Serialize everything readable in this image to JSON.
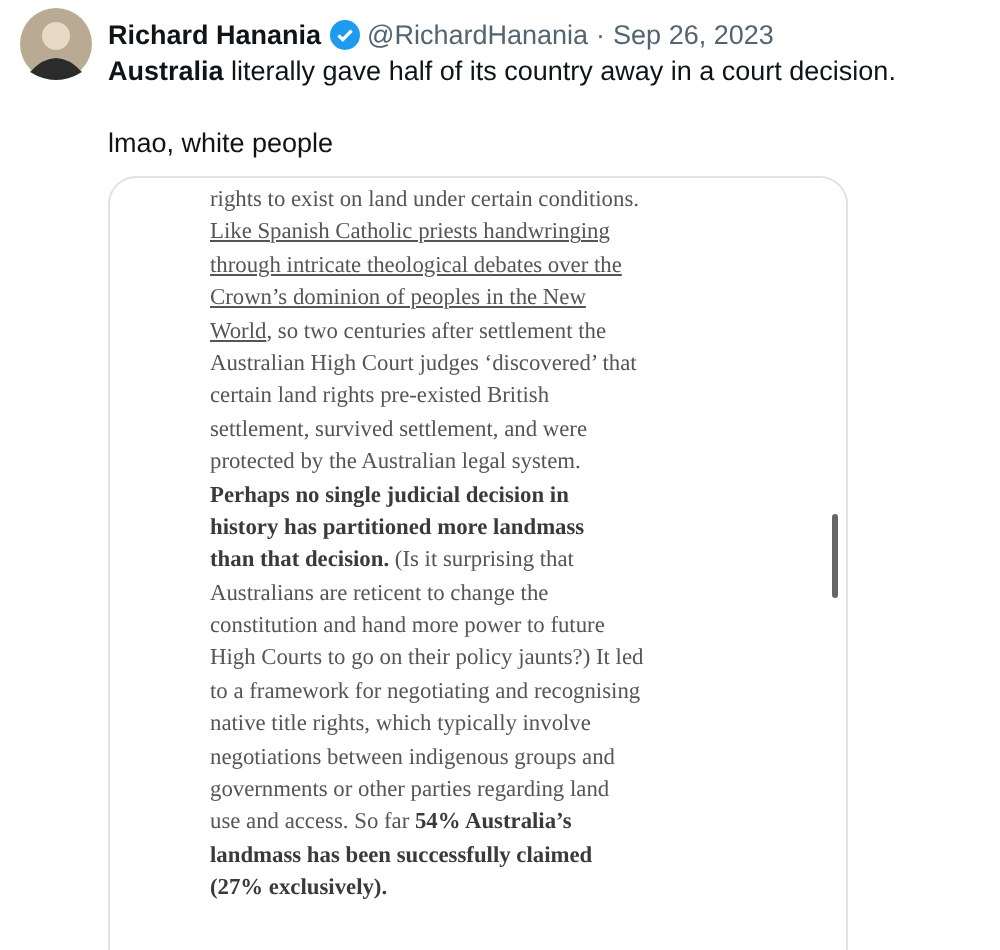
{
  "tweet": {
    "author": "Richard Hanania",
    "verified": true,
    "handle": "@RichardHanania",
    "separator": "·",
    "date": "Sep 26, 2023",
    "text": "**Australia** literally gave half of its country away in a court decision.",
    "comment": "lmao, white people"
  },
  "document": {
    "lines": [
      [
        {
          "kind": "plain",
          "text": "rights to exist on land under certain conditions."
        }
      ],
      [
        {
          "kind": "link",
          "text": "Like Spanish Catholic priests handwringing"
        }
      ],
      [
        {
          "kind": "link",
          "text": "through intricate theological debates over the"
        }
      ],
      [
        {
          "kind": "link",
          "text": "Crown’s dominion of peoples in the New"
        }
      ],
      [
        {
          "kind": "link",
          "text": "World"
        },
        {
          "kind": "plain",
          "text": ", so two centuries after settlement the"
        }
      ],
      [
        {
          "kind": "plain",
          "text": "Australian High Court judges ‘discovered’ that"
        }
      ],
      [
        {
          "kind": "plain",
          "text": "certain land rights pre-existed British"
        }
      ],
      [
        {
          "kind": "plain",
          "text": "settlement, survived settlement, and were"
        }
      ],
      [
        {
          "kind": "plain",
          "text": "protected by the Australian legal system."
        }
      ],
      [
        {
          "kind": "bold",
          "text": "Perhaps no single judicial decision in"
        }
      ],
      [
        {
          "kind": "bold",
          "text": "history has partitioned more landmass"
        }
      ],
      [
        {
          "kind": "bold",
          "text": "than that decision."
        },
        {
          "kind": "plain",
          "text": " (Is it surprising that"
        }
      ],
      [
        {
          "kind": "plain",
          "text": "Australians are reticent to change the"
        }
      ],
      [
        {
          "kind": "plain",
          "text": "constitution and hand more power to future"
        }
      ],
      [
        {
          "kind": "plain",
          "text": "High Courts to go on their policy jaunts?) It led"
        }
      ],
      [
        {
          "kind": "plain",
          "text": "to a framework for negotiating and recognising"
        }
      ],
      [
        {
          "kind": "plain",
          "text": "native title rights, which typically involve"
        }
      ],
      [
        {
          "kind": "plain",
          "text": "negotiations between indigenous groups and"
        }
      ],
      [
        {
          "kind": "plain",
          "text": "governments or other parties regarding land"
        }
      ],
      [
        {
          "kind": "plain",
          "text": "use and access. So far "
        },
        {
          "kind": "bold",
          "text": "54% Australia’s"
        }
      ],
      [
        {
          "kind": "bold",
          "text": "landmass has been successfully claimed"
        }
      ],
      [
        {
          "kind": "bold",
          "text": "(27% exclusively)."
        }
      ]
    ]
  }
}
